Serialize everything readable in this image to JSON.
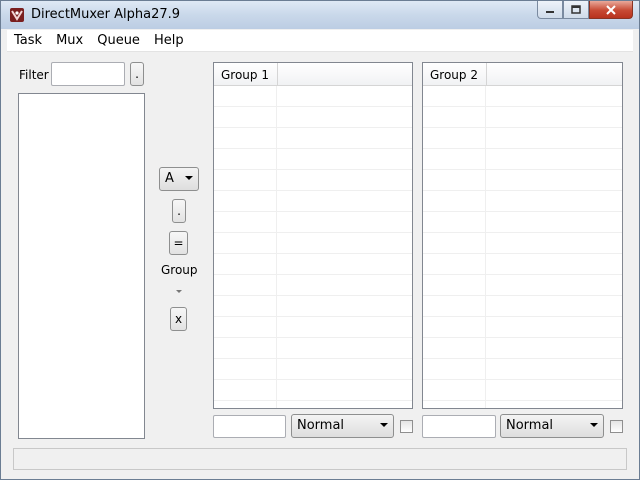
{
  "window": {
    "title": "DirectMuxer Alpha27.9"
  },
  "menu": {
    "items": [
      {
        "label": "Task"
      },
      {
        "label": "Mux"
      },
      {
        "label": "Queue"
      },
      {
        "label": "Help"
      }
    ]
  },
  "filter": {
    "label": "Filter",
    "value": "",
    "button_label": "."
  },
  "center_controls": {
    "combo_value": "A",
    "dot_button": ".",
    "equals_button": "=",
    "group_label": "Group",
    "remove_button": "x"
  },
  "groups": [
    {
      "header": "Group 1",
      "name_value": "",
      "priority": "Normal",
      "checked": false
    },
    {
      "header": "Group 2",
      "name_value": "",
      "priority": "Normal",
      "checked": false
    }
  ],
  "status": {
    "text": ""
  }
}
